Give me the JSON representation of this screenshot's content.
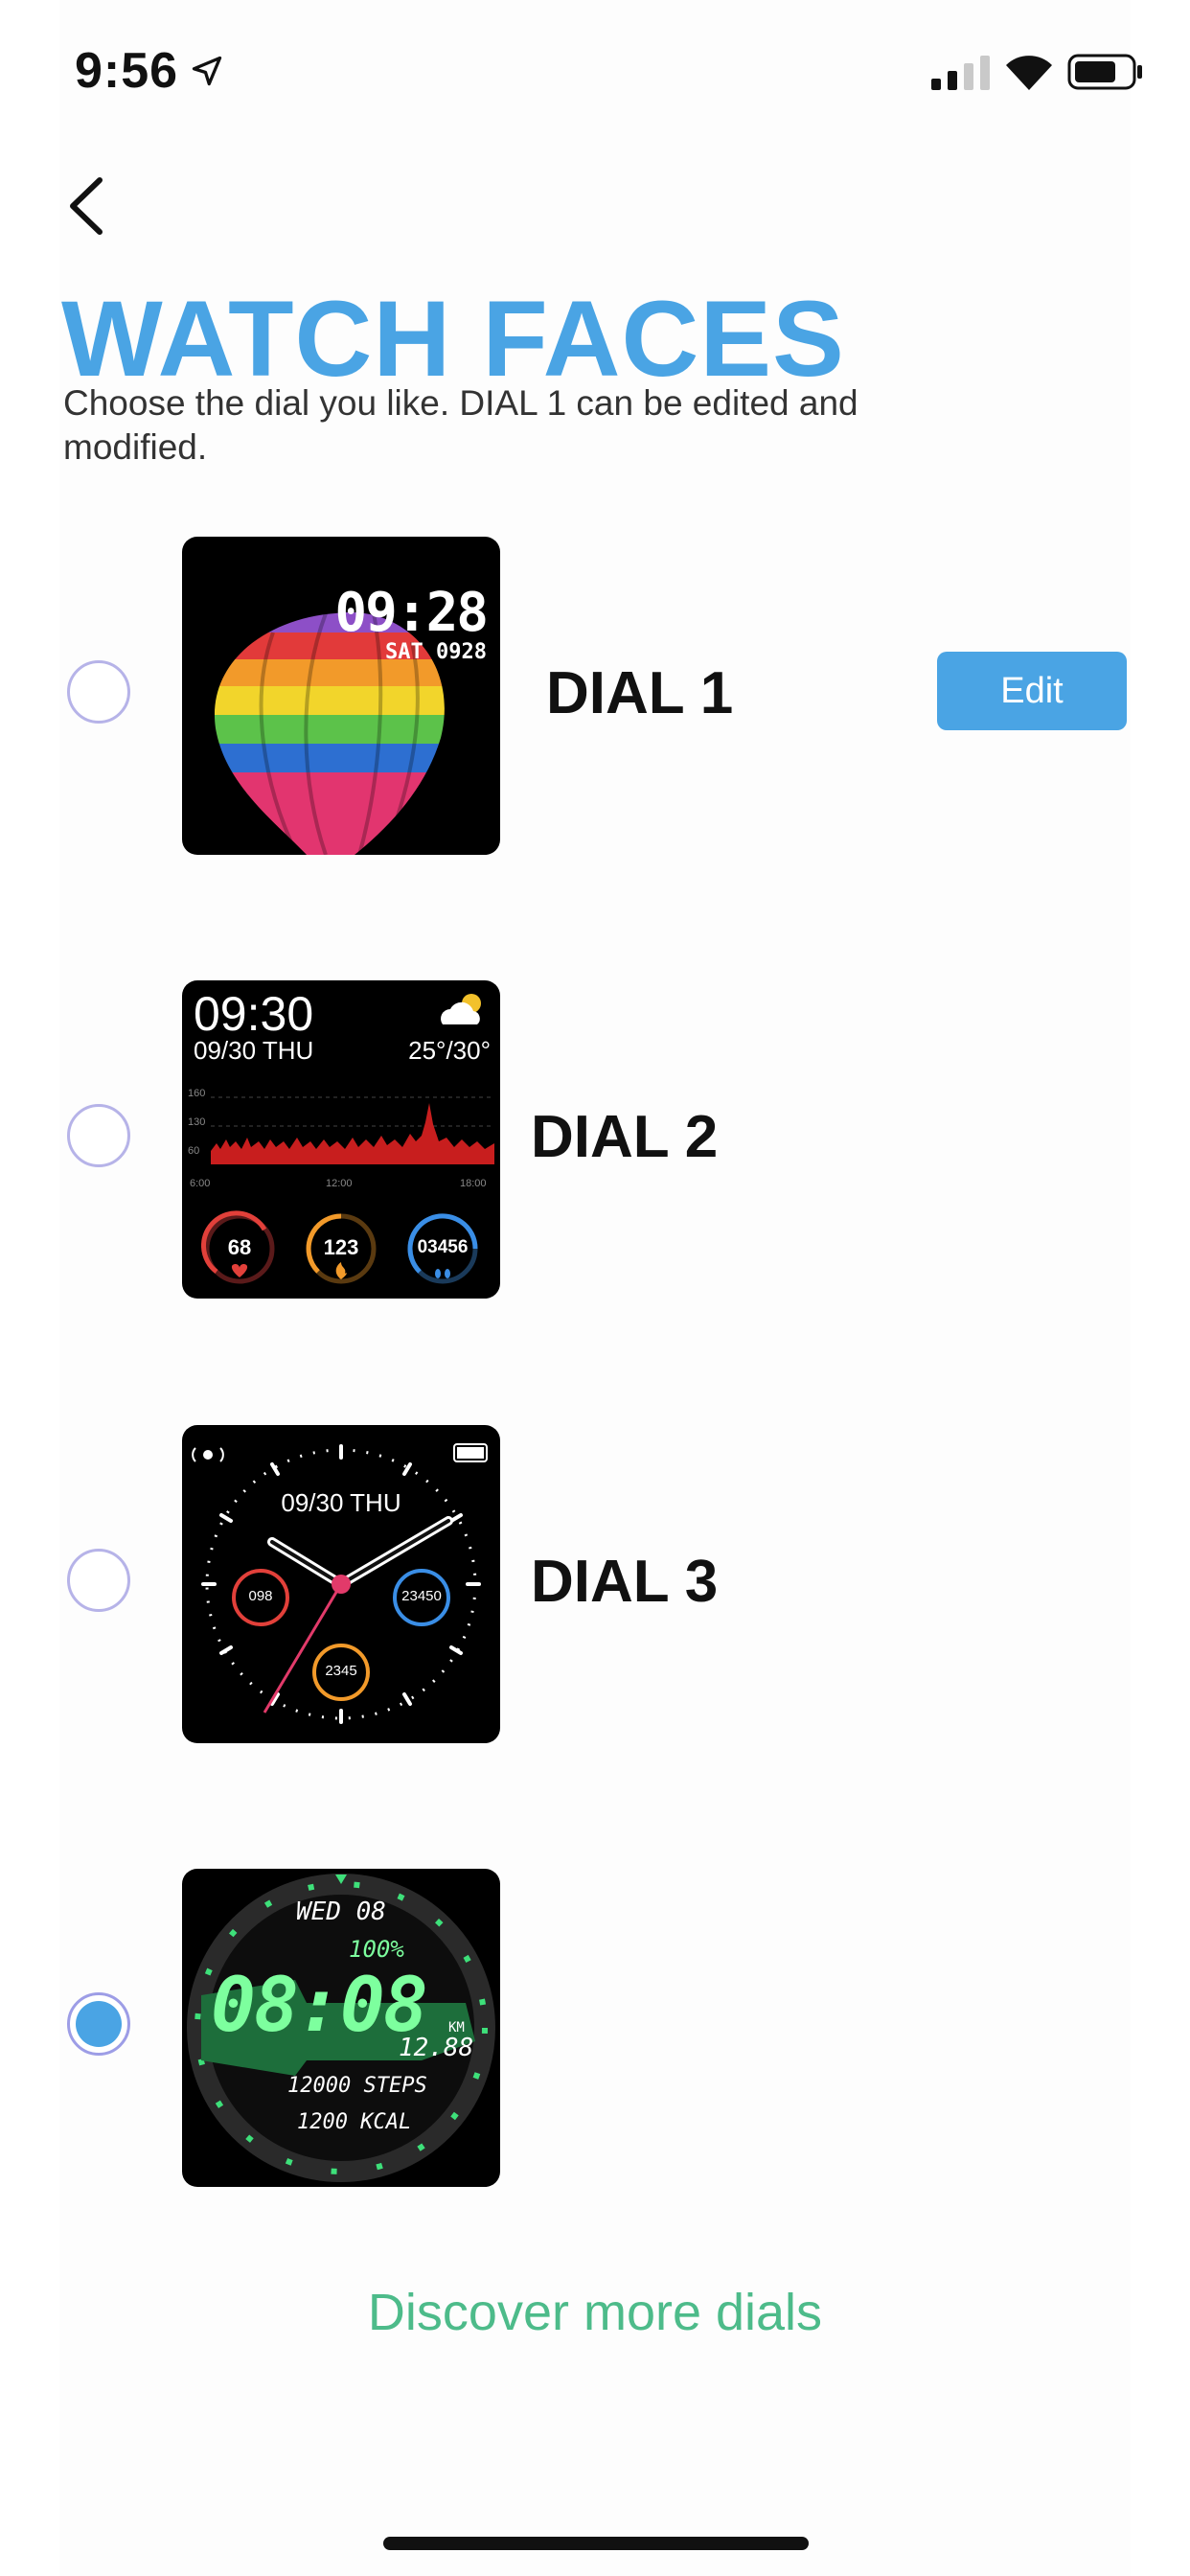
{
  "status_bar": {
    "time": "9:56"
  },
  "header": {
    "title": "WATCH FACES",
    "subtitle": "Choose the dial you like. DIAL 1 can be edited and modified."
  },
  "dials": [
    {
      "label": "DIAL 1",
      "selected": false,
      "edit_label": "Edit",
      "face": {
        "time": "09:28",
        "date": "SAT 0928"
      }
    },
    {
      "label": "DIAL 2",
      "selected": false,
      "face": {
        "time": "09:30",
        "date": "09/30 THU",
        "temp": "25°/30°",
        "y_ticks": [
          "160",
          "130",
          "60"
        ],
        "x_ticks": [
          "6:00",
          "12:00",
          "18:00"
        ],
        "heart": "68",
        "calories": "123",
        "steps": "03456"
      }
    },
    {
      "label": "DIAL 3",
      "selected": false,
      "face": {
        "date": "09/30 THU",
        "heart": "098",
        "steps": "23450",
        "calories": "2345"
      }
    },
    {
      "label": "",
      "selected": true,
      "face": {
        "day": "WED 08",
        "battery": "100%",
        "time": "08:08",
        "unit": "KM",
        "distance": "12.88",
        "steps": "12000 STEPS",
        "kcal": "1200 KCAL"
      }
    }
  ],
  "footer": {
    "discover": "Discover more dials"
  },
  "colors": {
    "accent": "#4aa4e4",
    "link": "#4dbb8a",
    "radio_border": "#b6b3e8"
  }
}
